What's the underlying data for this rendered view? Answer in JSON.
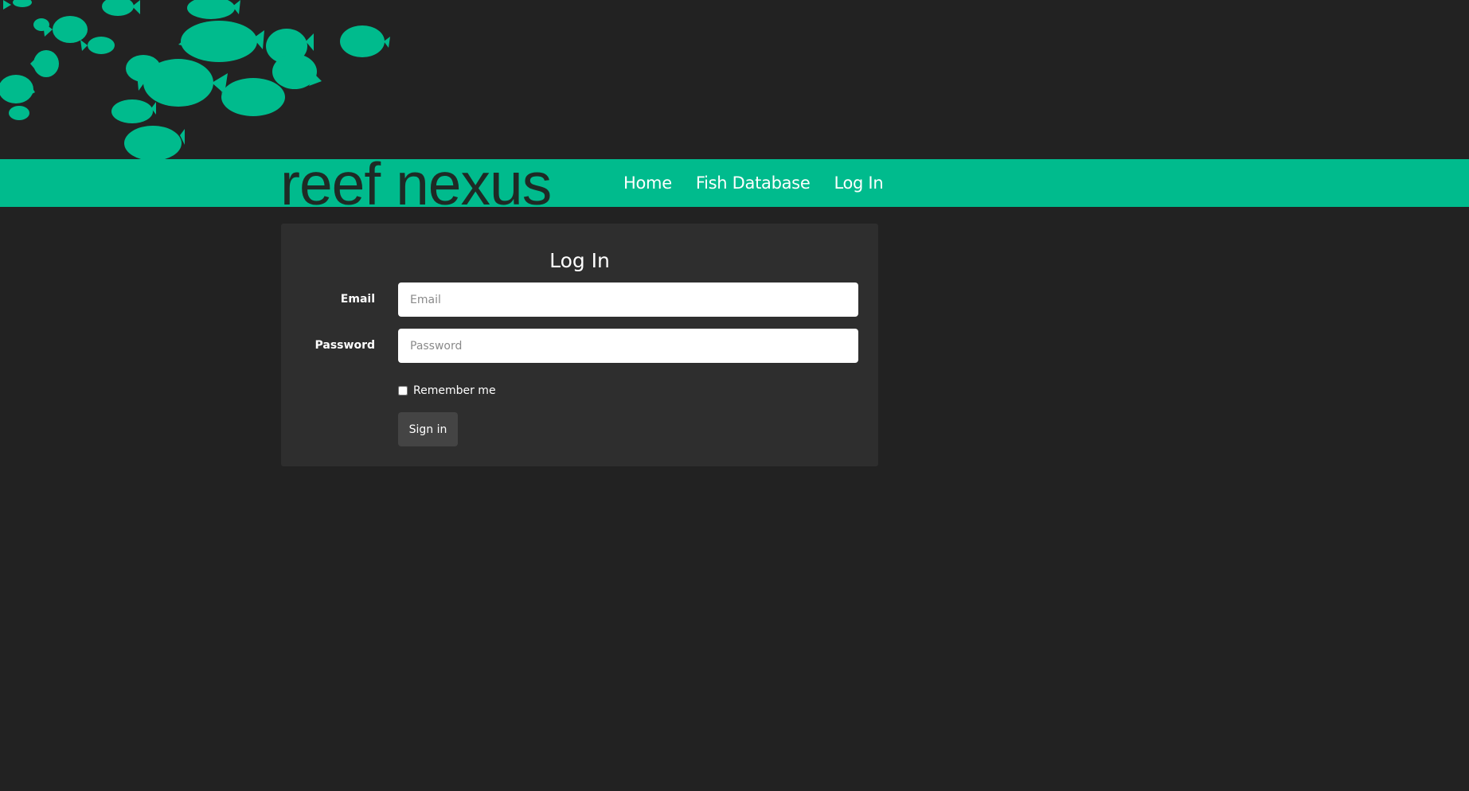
{
  "brand": {
    "name": "reef nexus"
  },
  "nav": {
    "items": [
      {
        "label": "Home"
      },
      {
        "label": "Fish Database"
      },
      {
        "label": "Log In"
      }
    ]
  },
  "login": {
    "title": "Log In",
    "email": {
      "label": "Email",
      "placeholder": "Email",
      "value": ""
    },
    "password": {
      "label": "Password",
      "placeholder": "Password",
      "value": ""
    },
    "remember_label": "Remember me",
    "remember_checked": false,
    "submit_label": "Sign in"
  },
  "colors": {
    "background": "#222222",
    "accent": "#00bb8d",
    "panel": "#2e2e2e",
    "button": "#444444",
    "brand_text": "#1e2a25"
  },
  "icons": {
    "header_art": "fish-school-icon"
  }
}
